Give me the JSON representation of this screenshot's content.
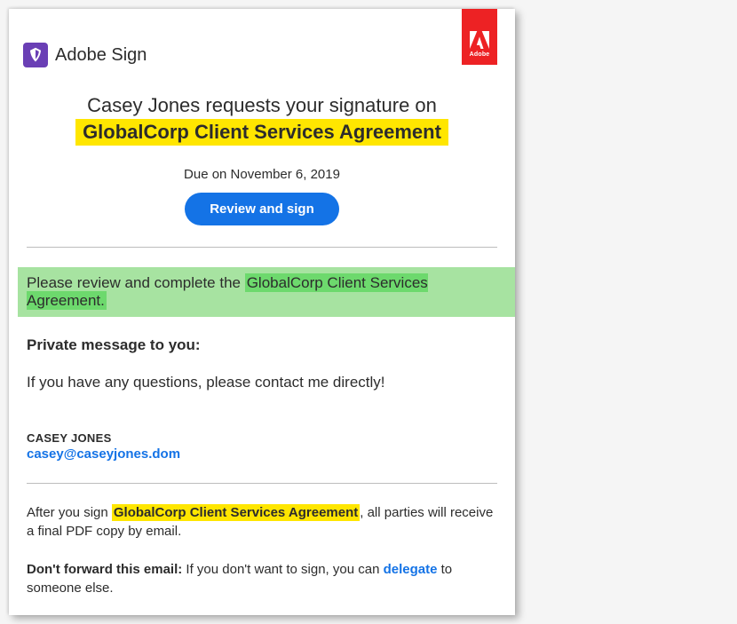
{
  "brand": {
    "product": "Adobe Sign",
    "badgeWord": "Adobe"
  },
  "hero": {
    "line1": "Casey Jones requests your signature on",
    "document": "GlobalCorp Client Services Agreement",
    "due": "Due on November 6, 2019",
    "cta": "Review and sign"
  },
  "review": {
    "prefix": "Please review and complete the ",
    "doc": "GlobalCorp Client Services Agreement."
  },
  "privateMessage": {
    "label": "Private message to you:",
    "body": "If you have any questions, please contact me directly!"
  },
  "sender": {
    "name": "CASEY JONES",
    "email": "casey@caseyjones.dom"
  },
  "footer1": {
    "prefix": "After you sign ",
    "doc": "GlobalCorp Client Services Agreement",
    "suffix": ", all parties will receive a final PDF copy by email."
  },
  "footer2": {
    "boldLead": "Don't forward this email:",
    "mid": " If you don't want to sign, you can ",
    "link": "delegate",
    "tail": " to someone else."
  }
}
